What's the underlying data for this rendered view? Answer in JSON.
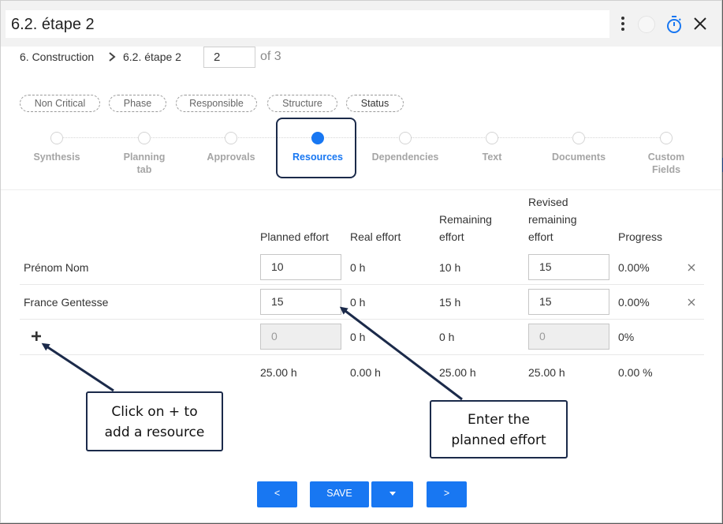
{
  "header": {
    "title": "6.2. étape 2"
  },
  "breadcrumb": {
    "parent": "6. Construction",
    "current": "6.2. étape 2",
    "page_value": "2",
    "page_of": "of 3"
  },
  "chips": [
    "Non Critical",
    "Phase",
    "Responsible",
    "Structure",
    "Status"
  ],
  "steps": [
    {
      "line1": "Synthesis",
      "line2": ""
    },
    {
      "line1": "Planning",
      "line2": "tab"
    },
    {
      "line1": "Approvals",
      "line2": ""
    },
    {
      "line1": "Resources",
      "line2": ""
    },
    {
      "line1": "Dependencies",
      "line2": ""
    },
    {
      "line1": "Text",
      "line2": ""
    },
    {
      "line1": "Documents",
      "line2": ""
    },
    {
      "line1": "Custom",
      "line2": "Fields"
    }
  ],
  "active_step_index": 3,
  "table": {
    "headers": {
      "planned": "Planned effort",
      "real": "Real effort",
      "remaining_1": "Remaining",
      "remaining_2": "effort",
      "revised_1": "Revised",
      "revised_2": "remaining",
      "revised_3": "effort",
      "progress": "Progress"
    },
    "rows": [
      {
        "name": "Prénom Nom",
        "planned": "10",
        "real": "0 h",
        "remaining": "10 h",
        "revised": "15",
        "progress": "0.00%"
      },
      {
        "name": "France Gentesse",
        "planned": "15",
        "real": "0 h",
        "remaining": "15 h",
        "revised": "15",
        "progress": "0.00%"
      }
    ],
    "new_row": {
      "planned": "0",
      "real": "0 h",
      "remaining": "0 h",
      "revised": "0",
      "progress": "0%"
    },
    "totals": {
      "planned": "25.00 h",
      "real": "0.00 h",
      "remaining": "25.00 h",
      "revised": "25.00 h",
      "progress": "0.00 %"
    }
  },
  "callouts": {
    "add_1": "Click on + to",
    "add_2": "add a resource",
    "effort_1": "Enter the",
    "effort_2": "planned effort"
  },
  "footer": {
    "prev_label": "<",
    "save_label": "SAVE",
    "next_label": ">"
  },
  "colors": {
    "accent": "#1877f2",
    "callout_border": "#1b2a4a"
  }
}
